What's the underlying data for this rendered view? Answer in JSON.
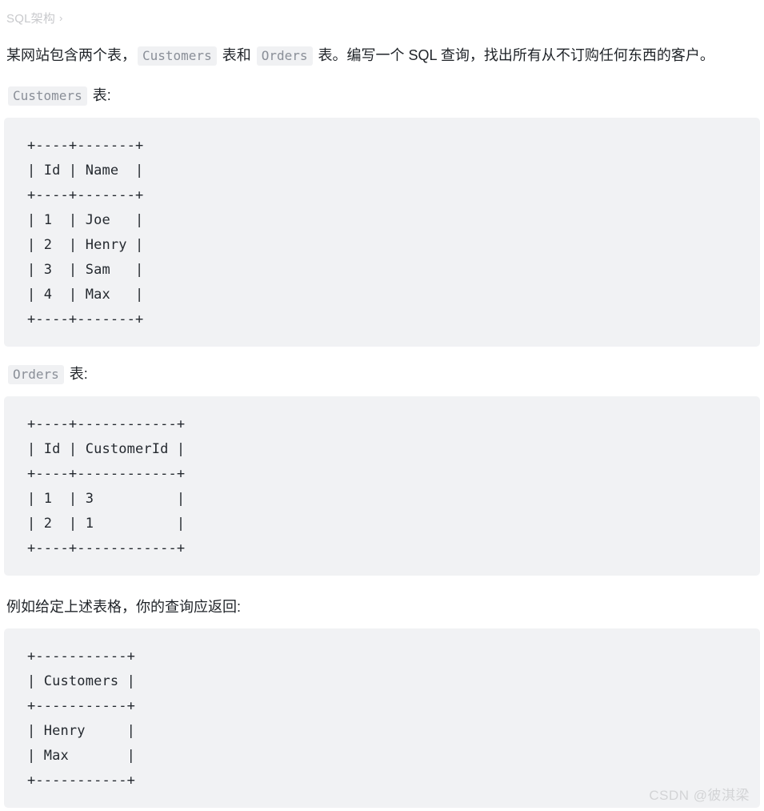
{
  "breadcrumb": {
    "label": "SQL架构",
    "separator": "›"
  },
  "content": {
    "intro": {
      "part1": "某网站包含两个表，",
      "code1": "Customers",
      "part2": " 表和 ",
      "code2": "Orders",
      "part3": " 表。编写一个 SQL 查询，找出所有从不订购任何东西的客户。"
    },
    "customers_label": {
      "code": "Customers",
      "text": " 表:"
    },
    "orders_label": {
      "code": "Orders",
      "text": " 表:"
    },
    "example_text": "例如给定上述表格，你的查询应返回:"
  },
  "code_blocks": {
    "customers_table": "+----+-------+\n| Id | Name  |\n+----+-------+\n| 1  | Joe   |\n| 2  | Henry |\n| 3  | Sam   |\n| 4  | Max   |\n+----+-------+",
    "orders_table": "+----+------------+\n| Id | CustomerId |\n+----+------------+\n| 1  | 3          |\n| 2  | 1          |\n+----+------------+",
    "result_table": "+-----------+\n| Customers |\n+-----------+\n| Henry     |\n| Max       |\n+-----------+"
  },
  "tables": {
    "customers": {
      "columns": [
        "Id",
        "Name"
      ],
      "rows": [
        [
          "1",
          "Joe"
        ],
        [
          "2",
          "Henry"
        ],
        [
          "3",
          "Sam"
        ],
        [
          "4",
          "Max"
        ]
      ]
    },
    "orders": {
      "columns": [
        "Id",
        "CustomerId"
      ],
      "rows": [
        [
          "1",
          "3"
        ],
        [
          "2",
          "1"
        ]
      ]
    },
    "result": {
      "columns": [
        "Customers"
      ],
      "rows": [
        [
          "Henry"
        ],
        [
          "Max"
        ]
      ]
    }
  },
  "watermark": {
    "text": "CSDN @彼淇梁"
  },
  "colors": {
    "page_background": "#ffffff",
    "code_background": "#f1f2f4",
    "inline_code_background": "#f0f1f3",
    "inline_code_text": "#8a8f98",
    "body_text": "#1f2328",
    "breadcrumb_text": "#c8c9cc",
    "watermark_text": "#d3d4d6"
  }
}
